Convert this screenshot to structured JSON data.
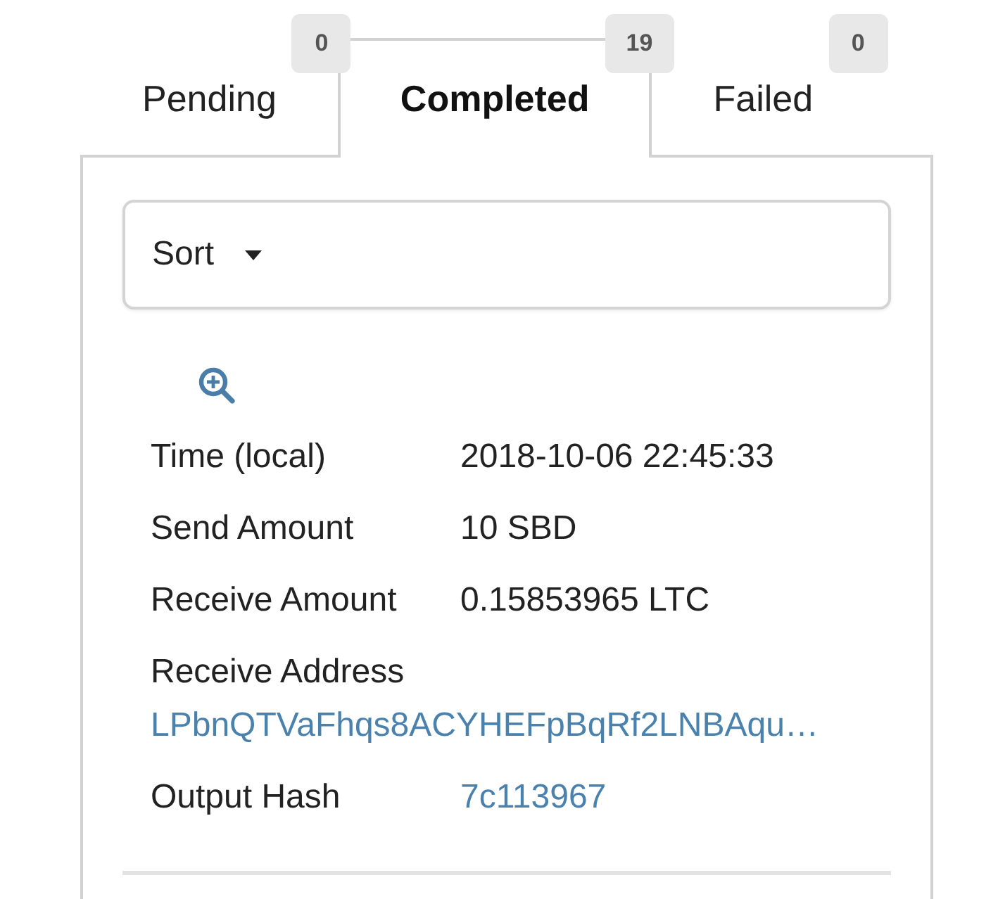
{
  "tabs": [
    {
      "label": "Pending",
      "count": "0",
      "selected": false
    },
    {
      "label": "Completed",
      "count": "19",
      "selected": true
    },
    {
      "label": "Failed",
      "count": "0",
      "selected": false
    }
  ],
  "sort": {
    "label": "Sort"
  },
  "details": [
    {
      "kind": "inline",
      "label": "Time (local)",
      "value": "2018-10-06 22:45:33",
      "link": false
    },
    {
      "kind": "inline",
      "label": "Send Amount",
      "value": "10 SBD",
      "link": false
    },
    {
      "kind": "inline",
      "label": "Receive Amount",
      "value": "0.15853965 LTC",
      "link": false
    },
    {
      "kind": "stacked",
      "label": "Receive Address",
      "value": "LPbnQTVaFhqs8ACYHEFpBqRf2LNBAqu…",
      "link": true
    },
    {
      "kind": "inline",
      "label": "Output Hash",
      "value": "7c113967",
      "link": true
    }
  ]
}
